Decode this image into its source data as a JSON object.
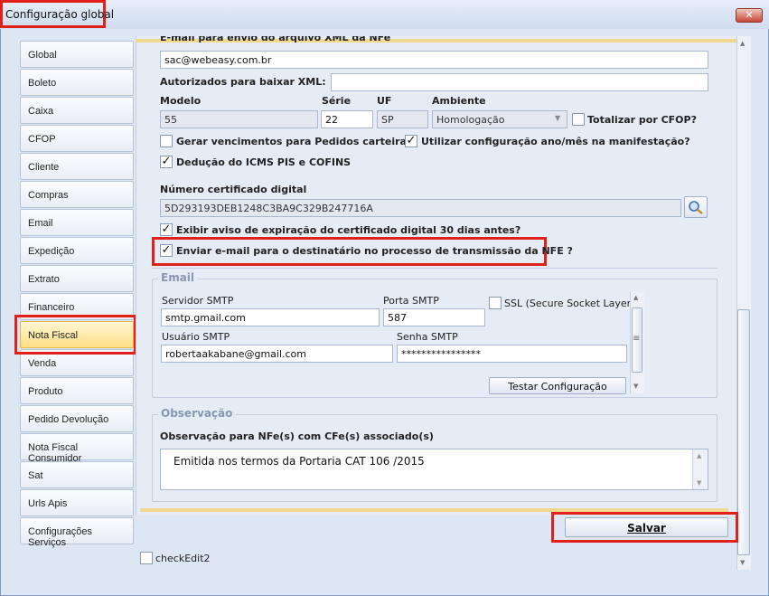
{
  "window": {
    "title": "Configuração global",
    "close": "✕"
  },
  "sidebar": {
    "items": [
      {
        "label": "Global"
      },
      {
        "label": "Boleto"
      },
      {
        "label": "Caixa"
      },
      {
        "label": "CFOP"
      },
      {
        "label": "Cliente"
      },
      {
        "label": "Compras"
      },
      {
        "label": "Email"
      },
      {
        "label": "Expedição"
      },
      {
        "label": "Extrato"
      },
      {
        "label": "Financeiro"
      },
      {
        "label": "Nota Fiscal"
      },
      {
        "label": "Venda"
      },
      {
        "label": "Produto"
      },
      {
        "label": "Pedido Devolução"
      },
      {
        "label": "Nota Fiscal Consumidor"
      },
      {
        "label": "Sat"
      },
      {
        "label": "Urls Apis"
      },
      {
        "label": "Configurações Serviços"
      }
    ],
    "active": "Nota Fiscal"
  },
  "nfe": {
    "email_label_partial": "E-mail para envio do arquivo XML da NFe",
    "email_value": "sac@webeasy.com.br",
    "autorizados_label": "Autorizados para baixar XML:",
    "autorizados_value": "",
    "modelo_label": "Modelo",
    "modelo_value": "55",
    "serie_label": "Série",
    "serie_value": "22",
    "uf_label": "UF",
    "uf_value": "SP",
    "ambiente_label": "Ambiente",
    "ambiente_value": "Homologação",
    "totalizar_label": "Totalizar por CFOP?",
    "gerar_label": "Gerar vencimentos para Pedidos carteira?",
    "utilizar_label": "Utilizar configuração ano/mês na manifestação?",
    "deducao_label": "Dedução do ICMS PIS e COFINS",
    "certificado_label": "Número certificado digital",
    "certificado_value": "5D293193DEB1248C3BA9C329B247716A",
    "aviso_label": "Exibir aviso de expiração do certificado digital 30 dias antes?",
    "enviar_label": "Enviar e-mail para o destinatário no processo de transmissão da NFE ?"
  },
  "email_group": {
    "title": "Email",
    "servidor_label": "Servidor SMTP",
    "servidor_value": "smtp.gmail.com",
    "porta_label": "Porta SMTP",
    "porta_value": "587",
    "ssl_label": "SSL (Secure Socket Layer)?",
    "usuario_label": "Usuário SMTP",
    "usuario_value": "robertaakabane@gmail.com",
    "senha_label": "Senha SMTP",
    "senha_value": "****************",
    "testar_label": "Testar Configuração"
  },
  "observacao": {
    "title": "Observação",
    "label": "Observação para NFe(s) com CFe(s) associado(s)",
    "value": "Emitida nos termos da Portaria CAT 106 /2015"
  },
  "footer": {
    "save_label": "Salvar",
    "checkedit_label": "checkEdit2"
  },
  "checks": {
    "checked_mark": "✓"
  },
  "icons": {
    "search": "search-icon",
    "dropdown": "▼",
    "scroll_up": "▲",
    "scroll_down": "▼",
    "grip": "≡"
  },
  "colors": {
    "highlight": "#e0211b",
    "active_item": "#ffdf86",
    "accent_line": "#f0d890"
  }
}
